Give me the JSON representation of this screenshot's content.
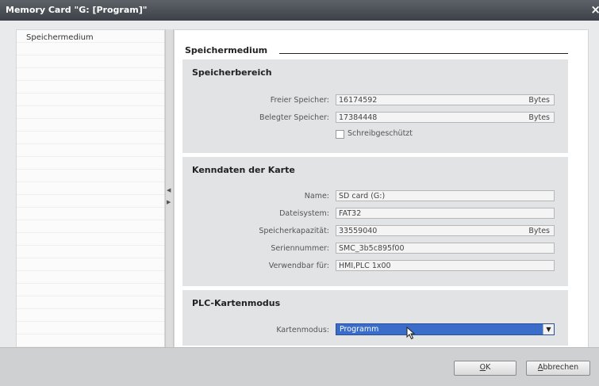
{
  "window": {
    "title": "Memory Card \"G: [Program]\"",
    "close_symbol": "×"
  },
  "nav": {
    "items": [
      {
        "label": "Speichermedium"
      }
    ]
  },
  "main": {
    "heading": "Speichermedium",
    "sections": {
      "storage": {
        "title": "Speicherbereich",
        "free_label": "Freier Speicher:",
        "free_value": "16174592",
        "free_unit": "Bytes",
        "used_label": "Belegter Speicher:",
        "used_value": "17384448",
        "used_unit": "Bytes",
        "writeprotect_label": "Schreibgeschützt",
        "writeprotect_checked": false
      },
      "card": {
        "title": "Kenndaten der Karte",
        "name_label": "Name:",
        "name_value": "SD card (G:)",
        "fs_label": "Dateisystem:",
        "fs_value": "FAT32",
        "capacity_label": "Speicherkapazität:",
        "capacity_value": "33559040",
        "capacity_unit": "Bytes",
        "serial_label": "Seriennummer:",
        "serial_value": "SMC_3b5c895f00",
        "usable_label": "Verwendbar für:",
        "usable_value": "HMI,PLC 1x00"
      },
      "mode": {
        "title": "PLC-Kartenmodus",
        "mode_label": "Kartenmodus:",
        "mode_value": "Programm"
      }
    }
  },
  "footer": {
    "ok_mnemonic": "O",
    "ok_rest": "K",
    "cancel_mnemonic": "A",
    "cancel_rest": "bbrechen"
  },
  "colors": {
    "titlebar": "#4b4f55",
    "selected_dropdown": "#3a6dc9",
    "section_bg": "#e2e3e5"
  }
}
